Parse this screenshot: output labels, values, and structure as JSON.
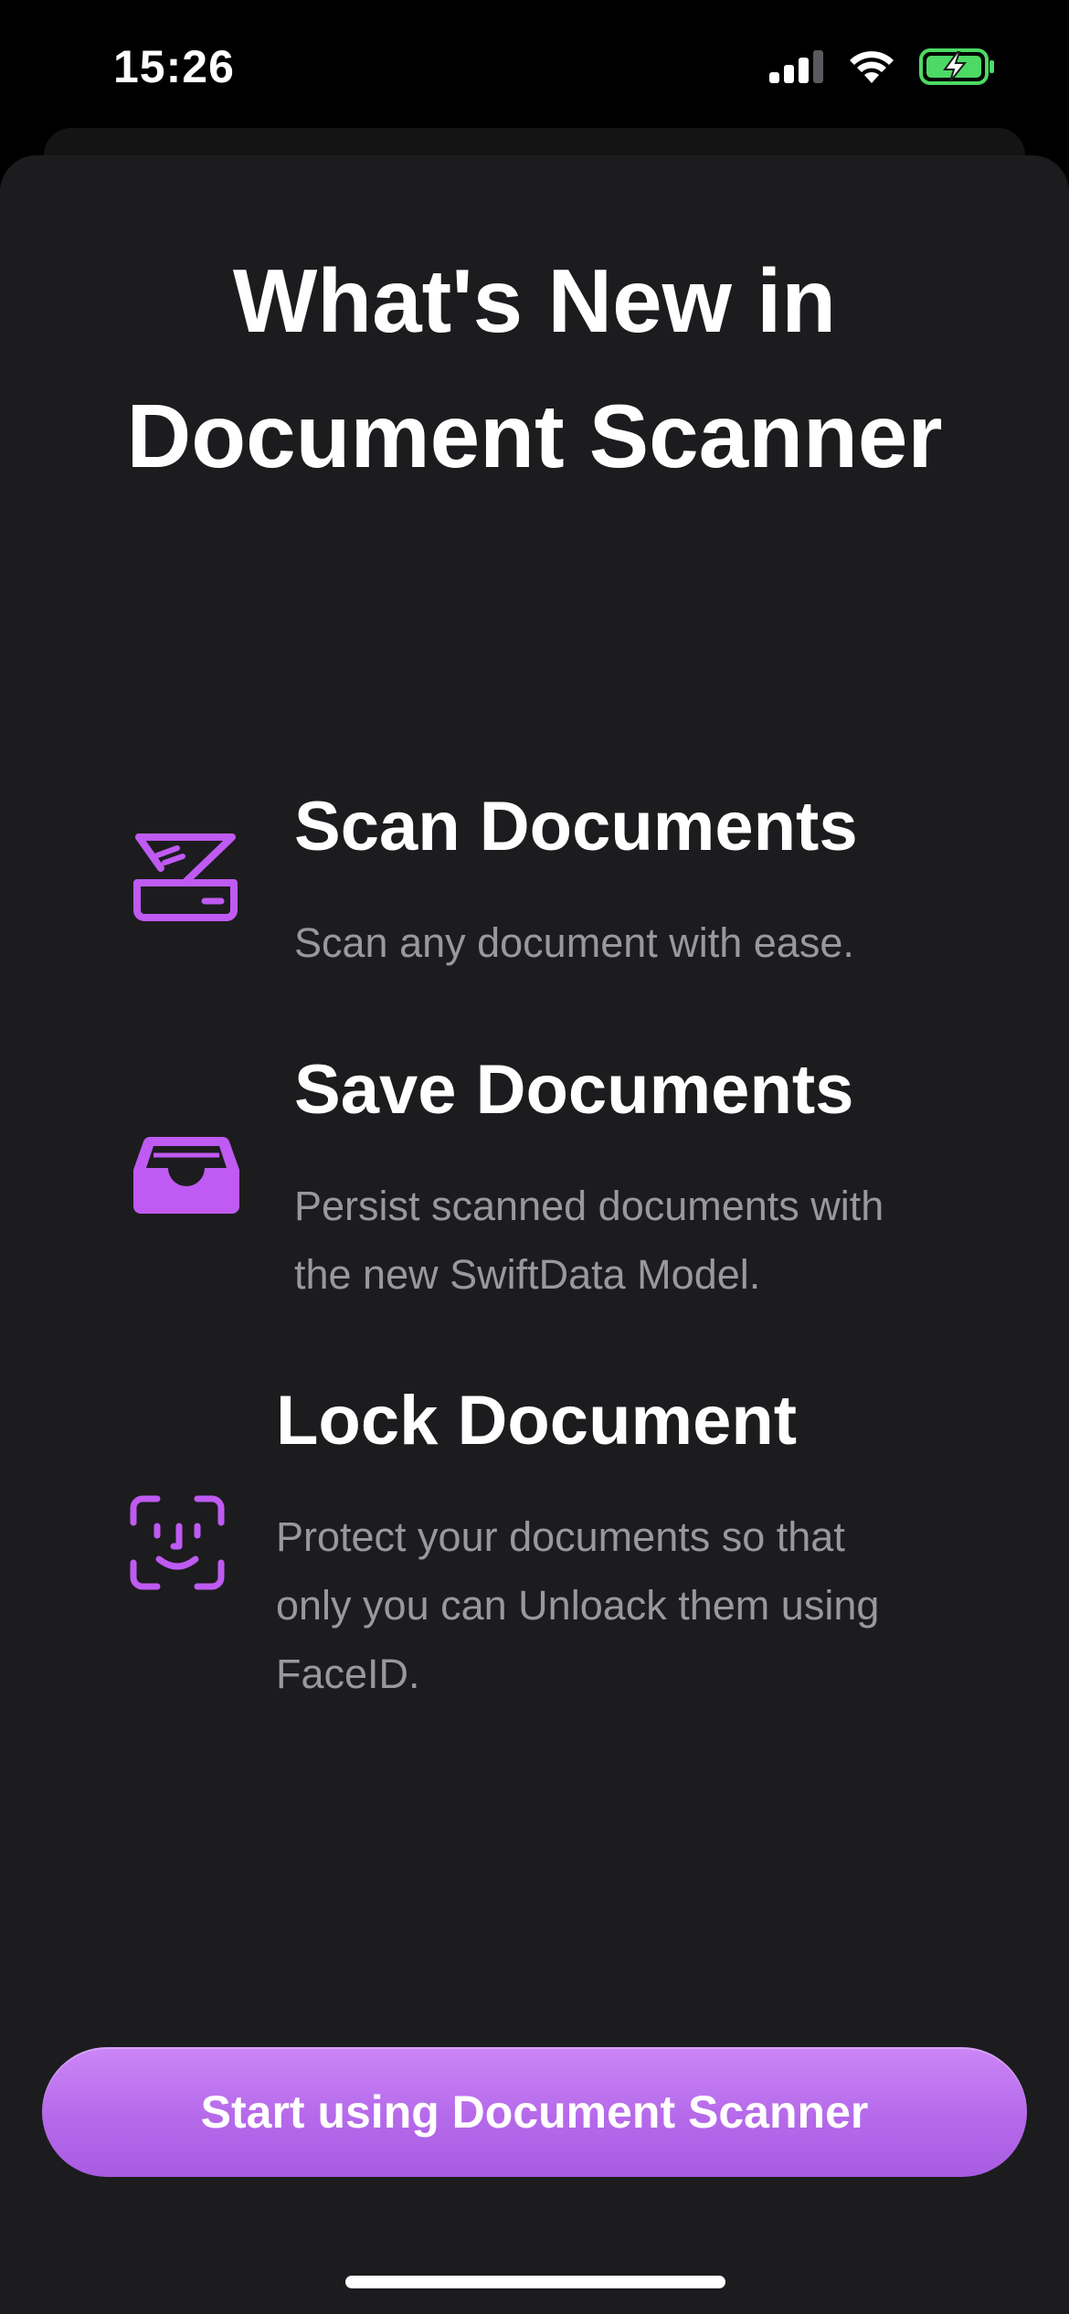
{
  "status_bar": {
    "time": "15:26",
    "battery_color": "#4cd964"
  },
  "accent_color": "#bf5af2",
  "title": "What's New in\nDocument Scanner",
  "features": [
    {
      "icon": "scanner-icon",
      "title": "Scan Documents",
      "description": "Scan any document with ease."
    },
    {
      "icon": "tray-icon",
      "title": "Save Documents",
      "description": "Persist scanned documents with\nthe new SwiftData Model."
    },
    {
      "icon": "faceid-icon",
      "title": "Lock Document",
      "description": "Protect your documents so that\nonly you can Unloack them using\nFaceID."
    }
  ],
  "cta": {
    "label": "Start using Document Scanner"
  }
}
